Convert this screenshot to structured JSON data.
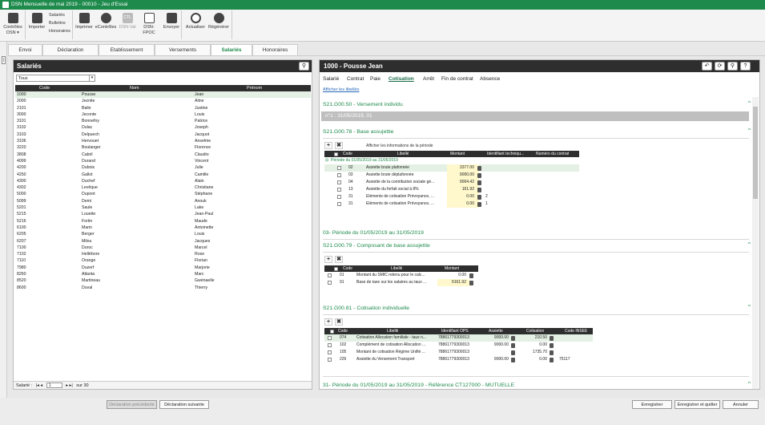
{
  "window": {
    "title": "DSN Mensuelle de mai 2019 - 00010 - Jeu d'Essai"
  },
  "ribbon": {
    "controles_label": "Contrôles DSN ▾",
    "importer_label": "Importer",
    "small_items": [
      "Salariés",
      "Bulletins",
      "Honoraires"
    ],
    "imprimer_label": "Imprimer",
    "econtroles_label": "eContrôles",
    "dsnval_label": "DSN-Val",
    "dsnval_icon_text": "CTL",
    "dsnfpoc_label": "DSN-FPOC",
    "envoyer_label": "Envoyer",
    "actualiser_label": "Actualiser",
    "regenerer_label": "Régénérer"
  },
  "tabs": [
    "Envoi",
    "Déclaration",
    "Etablissement",
    "Versements",
    "Salariés",
    "Honoraires"
  ],
  "active_tab": "Salariés",
  "left_strip_label": "|",
  "left": {
    "title": "Salariés",
    "filter": "Tous",
    "columns": [
      "Code",
      "Nom",
      "Prénom"
    ],
    "rows": [
      [
        "1000",
        "Pousse",
        "Jean"
      ],
      [
        "2000",
        "Jeznite",
        "Aline"
      ],
      [
        "2101",
        "Balin",
        "Justine"
      ],
      [
        "3000",
        "Jeconte",
        "Louis"
      ],
      [
        "3101",
        "Bonnefoy",
        "Patrice"
      ],
      [
        "3102",
        "Dulac",
        "Joseph"
      ],
      [
        "3103",
        "Delpuech",
        "Jacquot"
      ],
      [
        "3106",
        "Hervouet",
        "Anselme"
      ],
      [
        "3220",
        "Boulanger",
        "Florence"
      ],
      [
        "3808",
        "Cabril",
        "Claudio"
      ],
      [
        "4099",
        "Durand",
        "Vincent"
      ],
      [
        "4200",
        "Dubois",
        "Julie"
      ],
      [
        "4250",
        "Gallot",
        "Camille"
      ],
      [
        "4300",
        "Duchef",
        "Alain"
      ],
      [
        "4302",
        "Levêque",
        "Christiane"
      ],
      [
        "5000",
        "Dupont",
        "Stéphane"
      ],
      [
        "5099",
        "Demi",
        "Anouk"
      ],
      [
        "5201",
        "Saule",
        "Lake"
      ],
      [
        "5215",
        "Louette",
        "Jean-Paul"
      ],
      [
        "5216",
        "Fortin",
        "Maude"
      ],
      [
        "6100",
        "Marin",
        "Antoinette"
      ],
      [
        "6205",
        "Berger",
        "Louis"
      ],
      [
        "6207",
        "Milou",
        "Jacques"
      ],
      [
        "7100",
        "Duroc",
        "Marcel"
      ],
      [
        "7102",
        "Hellébore",
        "Rose"
      ],
      [
        "7110",
        "Orange",
        "Florian"
      ],
      [
        "7980",
        "Duzerf",
        "Marjorie"
      ],
      [
        "8260",
        "Atlanta",
        "Marc"
      ],
      [
        "8520",
        "Martineau",
        "Gwénaelle"
      ],
      [
        "8600",
        "Duval",
        "Thierry"
      ]
    ],
    "pager_prefix": "Salarié :",
    "pager_nav_prev": "|◂ ◂",
    "pager_nav_next": "▸ ▸|",
    "pager_value": "1",
    "pager_sep": "sur",
    "pager_total": "30"
  },
  "right": {
    "title": "1000 - Pousse Jean",
    "subtabs": [
      "Salarié",
      "Contrat",
      "Paie",
      "Cotisation",
      "Arrêt",
      "Fin de contrat",
      "Absence"
    ],
    "active_subtab": "Cotisation",
    "show_labels_link": "Afficher les libellés",
    "sections": {
      "s1": "S21.G00.50 - Versement individu",
      "band": "n°1 : 31/05/2019, 01",
      "s2": "S21.G00.78 - Base assujettie",
      "s3": "03- Période du 01/05/2019 au 31/05/2019",
      "s4": "S21.G00.79 - Composant de base assujettie",
      "s5": "S21.G00.81 - Cotisation individuelle",
      "s6": "31- Période du 01/05/2019 au 31/05/2019 - Référence CT127000 - MUTUELLE"
    },
    "toolbar": {
      "add": "+",
      "del": "✖"
    },
    "base_table": {
      "info_label": "Afficher les informations de la période",
      "columns": [
        "Code",
        "Libellé",
        "Montant",
        "Identifiant techniqu...",
        "Numéro du contrat"
      ],
      "group": "Période du 01/05/2019 au 31/05/2019",
      "rows": [
        {
          "code": "02",
          "label": "Assiette brute plafonnée",
          "montant": "3377.00",
          "id": ""
        },
        {
          "code": "03",
          "label": "Assiette brute déplafonnée",
          "montant": "9000.00",
          "id": ""
        },
        {
          "code": "04",
          "label": "Assiette de la contribution sociale gé...",
          "montant": "9004.42",
          "id": ""
        },
        {
          "code": "13",
          "label": "Assiette du forfait social à 8%",
          "montant": "161.92",
          "id": ""
        },
        {
          "code": "31",
          "label": "Eléments de cotisation Prévoyance, ...",
          "montant": "0.00",
          "id": "2"
        },
        {
          "code": "31",
          "label": "Eléments de cotisation Prévoyance, ...",
          "montant": "0.00",
          "id": "1"
        }
      ]
    },
    "comp_table": {
      "columns": [
        "Code",
        "Libellé",
        "Montant"
      ],
      "rows": [
        {
          "code": "01",
          "label": "Montant du SMIC retenu pour le calc...",
          "montant": "0.00"
        },
        {
          "code": "91",
          "label": "Base de taxe sur les salaires au taux ...",
          "montant": "9161.92"
        }
      ]
    },
    "cot_table": {
      "columns": [
        "Code",
        "Libellé",
        "Identifiant OPS",
        "Assiette",
        "Cotisation",
        "Code INSEE"
      ],
      "rows": [
        {
          "code": "074",
          "label": "Cotisation Allocation familiale - taux n...",
          "ops": "78861779300013",
          "assiette": "9000.00",
          "cotisation": "210.50",
          "insee": ""
        },
        {
          "code": "102",
          "label": "Complément de cotisation Allocation ...",
          "ops": "78861779300013",
          "assiette": "9000.00",
          "cotisation": "0.00",
          "insee": ""
        },
        {
          "code": "105",
          "label": "Montant de cotisation Régime Unifié ...",
          "ops": "78861779300013",
          "assiette": "",
          "cotisation": "1735.70",
          "insee": ""
        },
        {
          "code": "226",
          "label": "Assiette du Versement Transport",
          "ops": "78861779300013",
          "assiette": "9000.00",
          "cotisation": "0.00",
          "insee": "75117"
        }
      ]
    }
  },
  "footer": {
    "prev": "Déclaration précédente",
    "next": "Déclaration suivante",
    "save": "Enregistrer",
    "save_quit": "Enregistrer et quitter",
    "cancel": "Annuler"
  }
}
